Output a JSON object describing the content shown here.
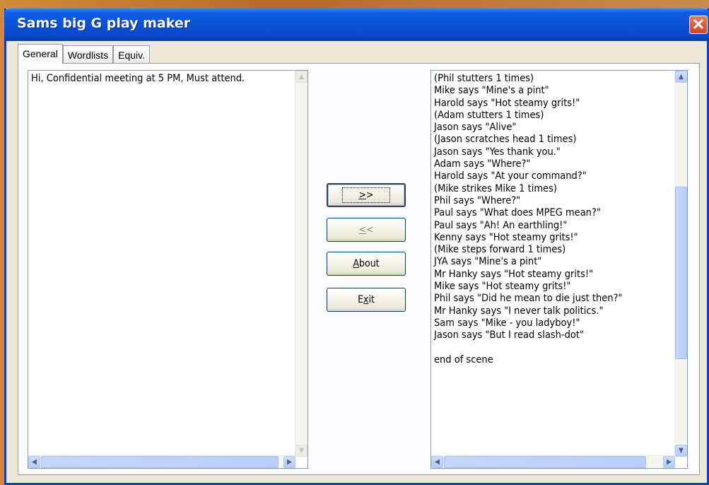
{
  "window": {
    "title": "Sams big G play maker",
    "close_glyph": "✕"
  },
  "tabs": [
    {
      "label": "General",
      "active": true
    },
    {
      "label": "Wordlists",
      "active": false
    },
    {
      "label": "Equiv.",
      "active": false
    }
  ],
  "input_text": "Hi, Confidential meeting at 5 PM, Must attend.",
  "buttons": {
    "forward": {
      "label": ">>",
      "mnemonic": ">"
    },
    "back": {
      "label": "<<",
      "mnemonic": "<"
    },
    "about": {
      "pre": "",
      "mnemonic": "A",
      "post": "bout"
    },
    "exit": {
      "pre": "E",
      "mnemonic": "x",
      "post": "it"
    }
  },
  "output_lines": [
    "(Phil stutters 1 times)",
    "Mike says \"Mine's a pint\"",
    "Harold says \"Hot steamy grits!\"",
    "(Adam stutters 1 times)",
    "Jason says \"Alive\"",
    "(Jason scratches head 1 times)",
    "Jason says \"Yes thank you.\"",
    "Adam says \"Where?\"",
    "Harold says \"At your command?\"",
    "(Mike strikes Mike 1 times)",
    "Phil says \"Where?\"",
    "Paul says \"What does MPEG mean?\"",
    "Paul says \"Ah! An earthling!\"",
    "Kenny says \"Hot steamy grits!\"",
    "(Mike steps forward 1 times)",
    "JYA says \"Mine's a pint\"",
    "Mr Hanky says \"Hot steamy grits!\"",
    "Mike says \"Hot steamy grits!\"",
    "Phil says \"Did he mean to die just then?\"",
    "Mr Hanky says \"I never talk politics.\"",
    "Sam says \"Mike - you ladyboy!\"",
    "Jason says \"But I read slash-dot\"",
    "",
    "end of scene"
  ],
  "scroll": {
    "up_glyph": "▲",
    "down_glyph": "▼",
    "left_glyph": "◀",
    "right_glyph": "▶",
    "output_vertical_position": 0.55
  },
  "colors": {
    "title_bar": "#0a52d6",
    "window_border": "#0a3fc4",
    "close_button": "#d2451f",
    "face": "#ece9d8"
  }
}
